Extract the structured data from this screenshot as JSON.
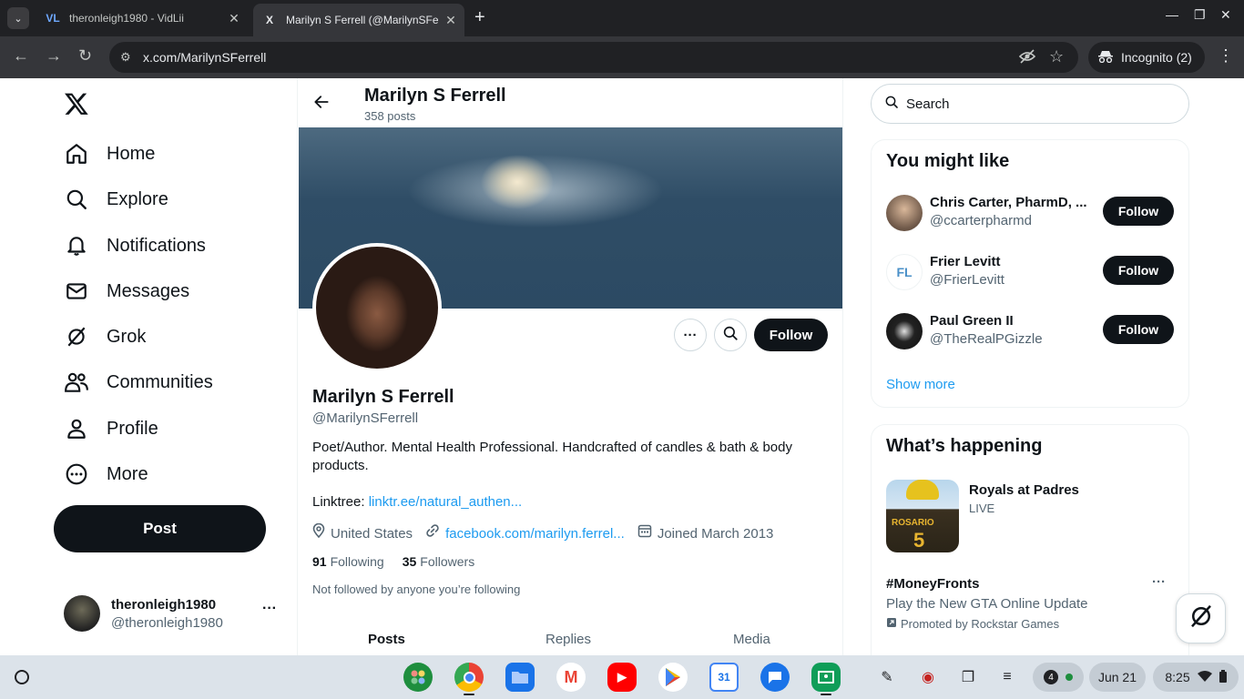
{
  "browser": {
    "tabs": [
      {
        "title": "theronleigh1980 - VidLii",
        "favicon": "VL"
      },
      {
        "title": "Marilyn S Ferrell (@MarilynSFe",
        "favicon": "X"
      }
    ],
    "url": "x.com/MarilynSFerrell",
    "incognito_label": "Incognito (2)"
  },
  "nav": {
    "items": [
      {
        "label": "Home",
        "icon": "home-icon"
      },
      {
        "label": "Explore",
        "icon": "search-icon"
      },
      {
        "label": "Notifications",
        "icon": "bell-icon"
      },
      {
        "label": "Messages",
        "icon": "mail-icon"
      },
      {
        "label": "Grok",
        "icon": "grok-icon"
      },
      {
        "label": "Communities",
        "icon": "people-icon"
      },
      {
        "label": "Profile",
        "icon": "person-icon"
      },
      {
        "label": "More",
        "icon": "more-circle-icon"
      }
    ],
    "post_label": "Post",
    "account": {
      "name": "theronleigh1980",
      "handle": "@theronleigh1980"
    }
  },
  "profile": {
    "header_name": "Marilyn S Ferrell",
    "post_count": "358 posts",
    "name": "Marilyn S Ferrell",
    "handle": "@MarilynSFerrell",
    "follow_label": "Follow",
    "bio": "Poet/Author. Mental Health Professional. Handcrafted of candles & bath & body products.",
    "linktree_prefix": "Linktree: ",
    "linktree_link": "linktr.ee/natural_authen...",
    "location": "United States",
    "website": "facebook.com/marilyn.ferrel...",
    "joined": "Joined March 2013",
    "following_count": "91",
    "following_label": "Following",
    "followers_count": "35",
    "followers_label": "Followers",
    "not_followed": "Not followed by anyone you’re following",
    "tabs": [
      "Posts",
      "Replies",
      "Media"
    ]
  },
  "sidebar": {
    "search_placeholder": "Search",
    "you_might_like": {
      "title": "You might like",
      "people": [
        {
          "name": "Chris Carter, PharmD, ...",
          "handle": "@ccarterpharmd",
          "button": "Follow"
        },
        {
          "name": "Frier Levitt",
          "handle": "@FrierLevitt",
          "button": "Follow"
        },
        {
          "name": "Paul Green II",
          "handle": "@TheRealPGizzle",
          "button": "Follow"
        }
      ],
      "show_more": "Show more"
    },
    "happening": {
      "title": "What’s happening",
      "event": {
        "title": "Royals at Padres",
        "status": "LIVE",
        "jersey_text": "ROSARIO",
        "jersey_number": "5"
      },
      "promo": {
        "tag": "#MoneyFronts",
        "text": "Play the New GTA Online Update",
        "promoted": "Promoted by Rockstar Games"
      }
    }
  },
  "shelf": {
    "notification_count": "4",
    "date": "Jun 21",
    "time": "8:25"
  }
}
